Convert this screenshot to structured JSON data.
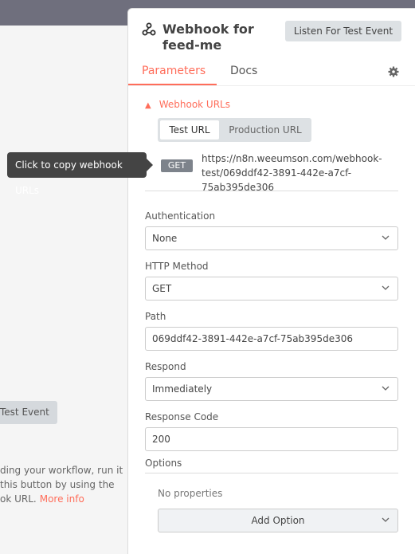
{
  "panel": {
    "title": "Webhook for feed-me",
    "listen_button": "Listen For Test Event",
    "tabs": [
      "Parameters",
      "Docs"
    ]
  },
  "webhook_urls": {
    "heading": "Webhook URLs",
    "toggle": [
      "Test URL",
      "Production URL"
    ],
    "method_badge": "GET",
    "url": "https://n8n.weeumson.com/webhook-test/069ddf42-3891-442e-a7cf-75ab395de306"
  },
  "tooltip": "Click to copy webhook URLs",
  "fields": {
    "authentication": {
      "label": "Authentication",
      "value": "None"
    },
    "http_method": {
      "label": "HTTP Method",
      "value": "GET"
    },
    "path": {
      "label": "Path",
      "value": "069ddf42-3891-442e-a7cf-75ab395de306"
    },
    "respond": {
      "label": "Respond",
      "value": "Immediately"
    },
    "response_code": {
      "label": "Response Code",
      "value": "200"
    }
  },
  "options": {
    "label": "Options",
    "empty": "No properties",
    "add_button": "Add Option"
  },
  "background": {
    "test_event_button": "Test Event",
    "help_lines": [
      "ding your workflow, run it",
      "this button by using the",
      "ok URL."
    ],
    "more_info": "More info"
  },
  "colors": {
    "accent": "#ff6d5a",
    "badge": "#7d838b",
    "tooltip_bg": "#444444"
  }
}
